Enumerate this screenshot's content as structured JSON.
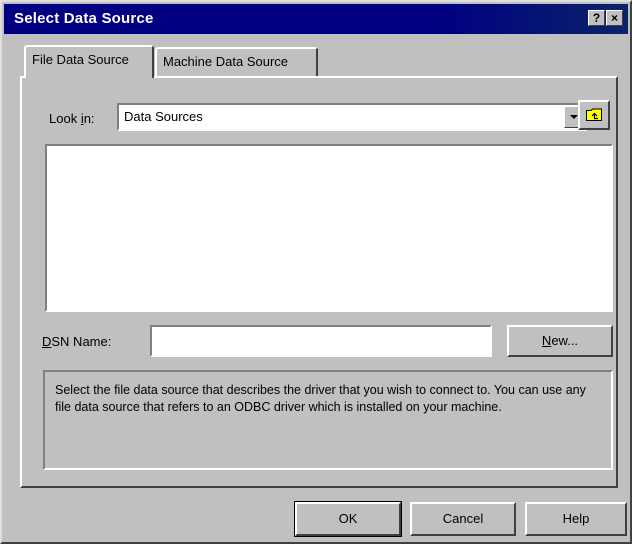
{
  "window": {
    "title": "Select Data Source",
    "help_glyph": "?",
    "close_glyph": "×"
  },
  "tabs": [
    {
      "label": "File Data Source",
      "active": true
    },
    {
      "label": "Machine Data Source",
      "active": false
    }
  ],
  "look_in": {
    "label_prefix": "Look ",
    "label_accel": "i",
    "label_suffix": "n:",
    "value": "Data Sources"
  },
  "dsn": {
    "label_accel": "D",
    "label_rest": "SN Name:",
    "value": ""
  },
  "buttons": {
    "new_accel": "N",
    "new_rest": "ew...",
    "ok": "OK",
    "cancel": "Cancel",
    "help": "Help"
  },
  "description": "Select the file data source that describes the driver that you wish to connect to. You can use any file data source that refers to an ODBC driver which is installed on your machine.",
  "icons": {
    "folder_up": "folder-up-icon",
    "dropdown": "dropdown-arrow-icon"
  },
  "colors": {
    "titlebar": "#000080",
    "face": "#c0c0c0",
    "folder": "#ffff00"
  }
}
